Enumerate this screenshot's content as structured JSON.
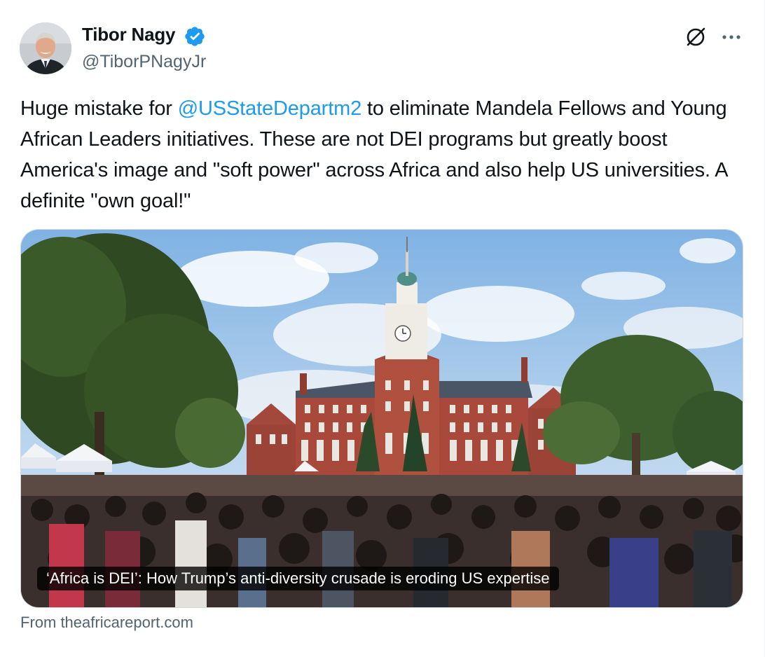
{
  "author": {
    "name": "Tibor Nagy",
    "handle": "@TiborPNagyJr",
    "verified": true,
    "verified_color": "#1d9bf0"
  },
  "header_actions": {
    "grok_icon": "grok-icon",
    "more_icon": "more-icon"
  },
  "tweet": {
    "text_before": "Huge mistake for ",
    "mention": "@USStateDepartm2",
    "text_after": " to eliminate Mandela Fellows and Young African Leaders initiatives. These are not DEI programs but greatly boost America's image and \"soft power\" across Africa and also help US universities. A definite \"own goal!\""
  },
  "link_card": {
    "title": "‘Africa is DEI’: How Trump’s anti-diversity crusade is eroding US expertise",
    "source": "From theafricareport.com"
  },
  "colors": {
    "link": "#1d9bf0",
    "text_primary": "#0f1419",
    "text_secondary": "#536471"
  }
}
